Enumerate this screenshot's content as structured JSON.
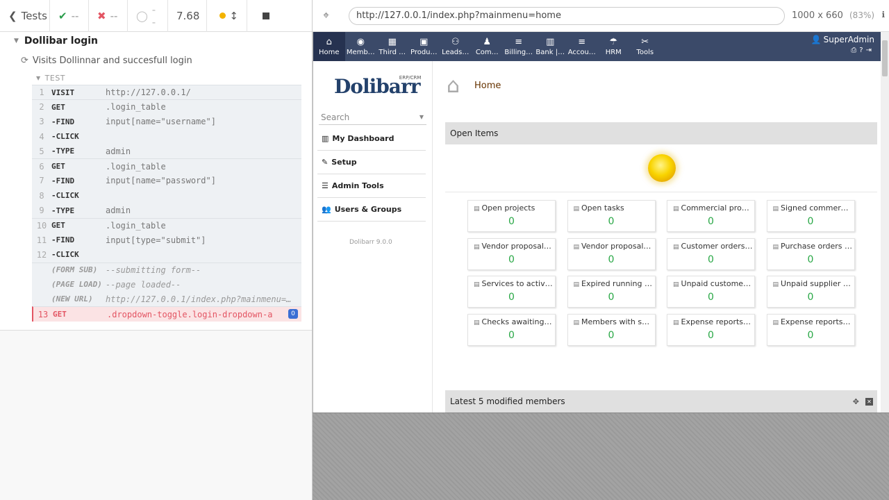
{
  "reporter": {
    "back_label": "Tests",
    "passed": "--",
    "failed": "--",
    "pending": "--",
    "duration": "7.68",
    "spec_title": "Dollibar login",
    "test_title": "Visits Dollinnar and succesfull login",
    "section_label": "TEST",
    "commands": [
      {
        "num": "1",
        "name": "VISIT",
        "msg": "http://127.0.0.1/"
      },
      {
        "num": "2",
        "name": "GET",
        "msg": ".login_table"
      },
      {
        "num": "3",
        "name": "-FIND",
        "msg": "input[name=\"username\"]"
      },
      {
        "num": "4",
        "name": "-CLICK",
        "msg": ""
      },
      {
        "num": "5",
        "name": "-TYPE",
        "msg": "admin"
      },
      {
        "num": "6",
        "name": "GET",
        "msg": ".login_table"
      },
      {
        "num": "7",
        "name": "-FIND",
        "msg": "input[name=\"password\"]"
      },
      {
        "num": "8",
        "name": "-CLICK",
        "msg": ""
      },
      {
        "num": "9",
        "name": "-TYPE",
        "msg": "admin"
      },
      {
        "num": "10",
        "name": "GET",
        "msg": ".login_table"
      },
      {
        "num": "11",
        "name": "-FIND",
        "msg": "input[type=\"submit\"]"
      },
      {
        "num": "12",
        "name": "-CLICK",
        "msg": ""
      },
      {
        "num": "",
        "name": "(FORM SUB)",
        "msg": "--submitting form--"
      },
      {
        "num": "",
        "name": "(PAGE LOAD)",
        "msg": "--page loaded--"
      },
      {
        "num": "",
        "name": "(NEW URL)",
        "msg": "http://127.0.0.1/index.php?mainmenu=home"
      },
      {
        "num": "13",
        "name": "GET",
        "msg": ".dropdown-toggle.login-dropdown-a",
        "badge": "0"
      }
    ]
  },
  "aut": {
    "url": "http://127.0.0.1/index.php?mainmenu=home",
    "viewport": "1000 x 660",
    "scale": "(83%)"
  },
  "dolibarr": {
    "menu": [
      {
        "label": "Home",
        "icon": "⌂"
      },
      {
        "label": "Memb…",
        "icon": "◉"
      },
      {
        "label": "Third …",
        "icon": "▦"
      },
      {
        "label": "Produ…",
        "icon": "▣"
      },
      {
        "label": "Leads…",
        "icon": "⚇"
      },
      {
        "label": "Com…",
        "icon": "♟"
      },
      {
        "label": "Billing…",
        "icon": "≡"
      },
      {
        "label": "Bank |…",
        "icon": "▥"
      },
      {
        "label": "Accou…",
        "icon": "≡"
      },
      {
        "label": "HRM",
        "icon": "☂"
      },
      {
        "label": "Tools",
        "icon": "✂"
      }
    ],
    "user": "SuperAdmin",
    "logo": "Dolibarr",
    "logo_tag": "ERP/CRM",
    "search_placeholder": "Search",
    "side": [
      "My Dashboard",
      "Setup",
      "Admin Tools",
      "Users & Groups"
    ],
    "version": "Dolibarr 9.0.0",
    "page_title": "Home",
    "open_items": "Open Items",
    "tiles": [
      {
        "label": "Open projects",
        "value": "0"
      },
      {
        "label": "Open tasks",
        "value": "0"
      },
      {
        "label": "Commercial prop…",
        "value": "0"
      },
      {
        "label": "Signed commerci…",
        "value": "0"
      },
      {
        "label": "Vendor proposals…",
        "value": "0"
      },
      {
        "label": "Vendor proposals…",
        "value": "0"
      },
      {
        "label": "Customer orders …",
        "value": "0"
      },
      {
        "label": "Purchase orders …",
        "value": "0"
      },
      {
        "label": "Services to activ…",
        "value": "0"
      },
      {
        "label": "Expired running s…",
        "value": "0"
      },
      {
        "label": "Unpaid customer…",
        "value": "0"
      },
      {
        "label": "Unpaid supplier i…",
        "value": "0"
      },
      {
        "label": "Checks awaiting …",
        "value": "0"
      },
      {
        "label": "Members with su…",
        "value": "0"
      },
      {
        "label": "Expense reports …",
        "value": "0"
      },
      {
        "label": "Expense reports …",
        "value": "0"
      }
    ],
    "latest_members": "Latest 5 modified members"
  }
}
